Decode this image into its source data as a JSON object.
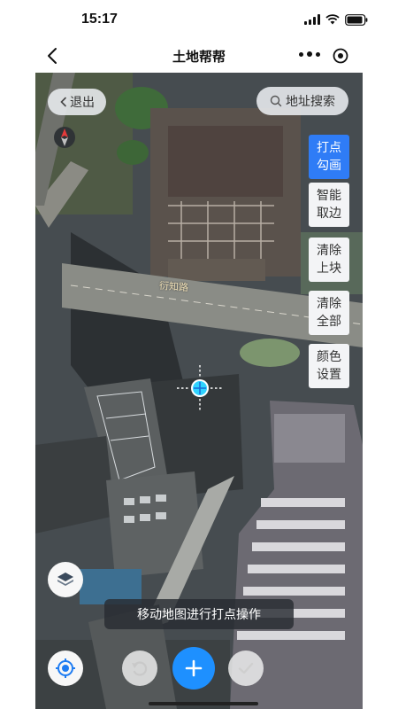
{
  "status_bar": {
    "time": "15:17"
  },
  "nav": {
    "title": "土地帮帮"
  },
  "map": {
    "exit_label": "退出",
    "search_label": "地址搜索",
    "road_label": "衍知路",
    "tools": [
      {
        "line1": "打点",
        "line2": "勾画",
        "active": true
      },
      {
        "line1": "智能",
        "line2": "取边",
        "active": false
      },
      {
        "line1": "清除",
        "line2": "上块",
        "active": false
      },
      {
        "line1": "清除",
        "line2": "全部",
        "active": false
      },
      {
        "line1": "颜色",
        "line2": "设置",
        "active": false
      }
    ],
    "hint": "移动地图进行打点操作"
  },
  "colors": {
    "accent": "#2f7cf6",
    "add_button": "#1e90ff",
    "crosshair": "#2fd3ff"
  },
  "icons": {
    "back": "chevron-left-icon",
    "more": "more-dots-icon",
    "target": "target-icon",
    "search": "search-icon",
    "compass": "compass-icon",
    "layers": "layers-icon",
    "locate": "locate-icon",
    "undo": "undo-icon",
    "add": "plus-icon",
    "confirm": "check-icon"
  }
}
